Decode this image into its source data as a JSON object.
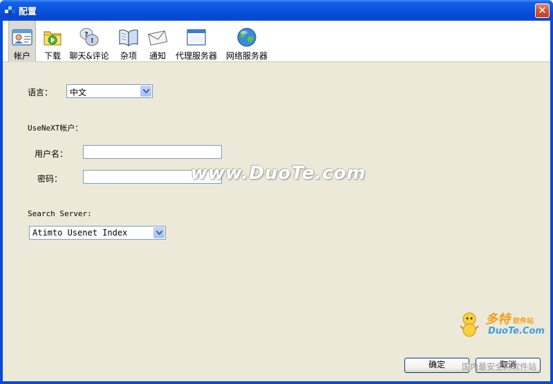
{
  "window": {
    "title": "配置",
    "close_glyph": "✕"
  },
  "toolbar": {
    "items": [
      {
        "label": "帐户",
        "icon": "account-icon"
      },
      {
        "label": "下载",
        "icon": "download-icon"
      },
      {
        "label": "聊天&评论",
        "icon": "chat-icon"
      },
      {
        "label": "杂项",
        "icon": "misc-book-icon"
      },
      {
        "label": "通知",
        "icon": "mail-icon"
      },
      {
        "label": "代理服务器",
        "icon": "proxy-window-icon"
      },
      {
        "label": "网络服务器",
        "icon": "globe-icon"
      }
    ],
    "selected_index": 0
  },
  "form": {
    "language_label": "语言：",
    "language_value": "中文",
    "usenext_label": "UseNeXT帐户：",
    "username_label": "用户名：",
    "username_value": "",
    "password_label": "密码：",
    "password_value": "",
    "search_server_label": "Search Server:",
    "search_server_value": "Atimto Usenet Index"
  },
  "buttons": {
    "ok": "确定",
    "cancel": "取消"
  },
  "watermark": {
    "center_text": "www.DuoTe.com",
    "logo_cn": "多特",
    "logo_cn_small": "软件站",
    "logo_en": "DuoTe.Com",
    "logo_tagline": "国内最安全的软件站"
  }
}
